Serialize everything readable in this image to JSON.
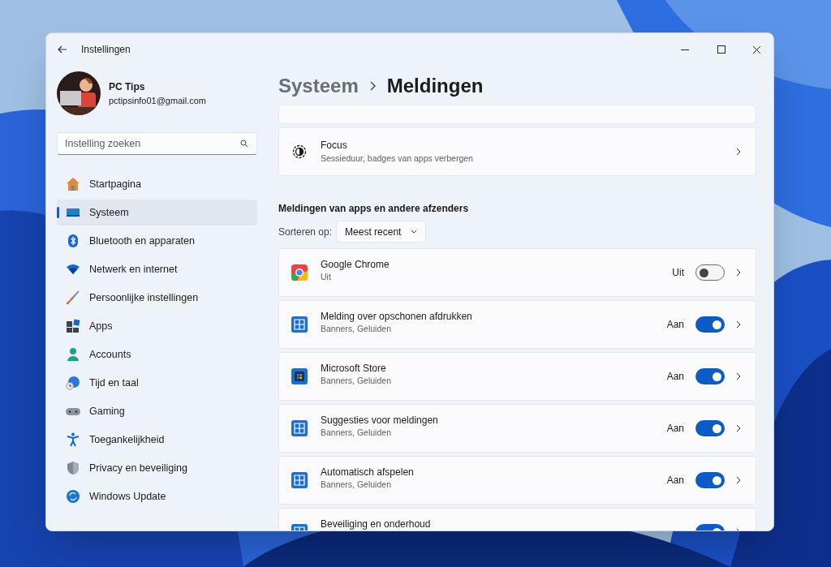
{
  "window": {
    "title": "Instellingen"
  },
  "profile": {
    "name": "PC Tips",
    "email": "pctipsinfo01@gmail.com"
  },
  "search": {
    "placeholder": "Instelling zoeken"
  },
  "nav": [
    {
      "label": "Startpagina",
      "selected": false
    },
    {
      "label": "Systeem",
      "selected": true
    },
    {
      "label": "Bluetooth en apparaten",
      "selected": false
    },
    {
      "label": "Netwerk en internet",
      "selected": false
    },
    {
      "label": "Persoonlijke instellingen",
      "selected": false
    },
    {
      "label": "Apps",
      "selected": false
    },
    {
      "label": "Accounts",
      "selected": false
    },
    {
      "label": "Tijd en taal",
      "selected": false
    },
    {
      "label": "Gaming",
      "selected": false
    },
    {
      "label": "Toegankelijkheid",
      "selected": false
    },
    {
      "label": "Privacy en beveiliging",
      "selected": false
    },
    {
      "label": "Windows Update",
      "selected": false
    }
  ],
  "breadcrumb": [
    "Systeem",
    "Meldingen"
  ],
  "focus": {
    "title": "Focus",
    "subtitle": "Sessieduur, badges van apps verbergen"
  },
  "section_title": "Meldingen van apps en andere afzenders",
  "sort": {
    "label": "Sorteren op:",
    "value": "Meest recent"
  },
  "apps": [
    {
      "kind": "chrome",
      "name": "Google Chrome",
      "subtitle": "Uit",
      "state_label": "Uit",
      "on": false
    },
    {
      "kind": "system",
      "name": "Melding over opschonen afdrukken",
      "subtitle": "Banners, Geluiden",
      "state_label": "Aan",
      "on": true
    },
    {
      "kind": "store",
      "name": "Microsoft Store",
      "subtitle": "Banners, Geluiden",
      "state_label": "Aan",
      "on": true
    },
    {
      "kind": "system",
      "name": "Suggesties voor meldingen",
      "subtitle": "Banners, Geluiden",
      "state_label": "Aan",
      "on": true
    },
    {
      "kind": "system",
      "name": "Automatisch afspelen",
      "subtitle": "Banners, Geluiden",
      "state_label": "Aan",
      "on": true
    },
    {
      "kind": "system",
      "name": "Beveiliging en onderhoud",
      "on": true
    }
  ]
}
